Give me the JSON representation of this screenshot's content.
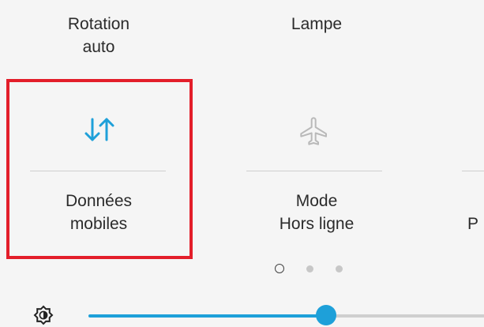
{
  "tiles": {
    "rotation": {
      "line1": "Rotation",
      "line2": "auto"
    },
    "lamp": {
      "line1": "Lampe"
    },
    "mobile_data": {
      "line1": "Données",
      "line2": "mobiles",
      "icon": "data-transfer-arrows-icon",
      "color": "#1ea0d9"
    },
    "airplane": {
      "line1": "Mode",
      "line2": "Hors ligne",
      "icon": "airplane-icon",
      "color": "#b9b9b9"
    },
    "next_partial": {
      "line1": "P"
    }
  },
  "pager": {
    "pages": 3,
    "active_index": 0
  },
  "brightness": {
    "icon": "brightness-icon",
    "level": 0.6,
    "accent": "#1ea0d9"
  },
  "highlight_color": "#e31e2a"
}
